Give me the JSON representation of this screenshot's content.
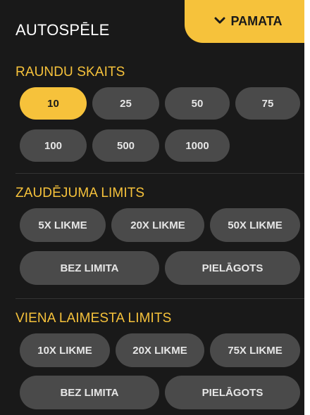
{
  "header": {
    "title": "AUTOSPĒLE",
    "tab_label": "PAMATA",
    "tab_icon": "chevron-down-icon"
  },
  "colors": {
    "accent": "#f6c23b",
    "panel_bg": "#191919",
    "button_bg": "#4a4a4a",
    "button_text": "#e6e6e6"
  },
  "rounds": {
    "title": "RAUNDU SKAITS",
    "options": [
      "10",
      "25",
      "50",
      "75",
      "100",
      "500",
      "1000"
    ],
    "selected": "10"
  },
  "loss_limit": {
    "title": "ZAUDĒJUMA LIMITS",
    "options": [
      "5X LIKME",
      "20X LIKME",
      "50X LIKME",
      "BEZ LIMITA",
      "PIELĀGOTS"
    ]
  },
  "single_win_limit": {
    "title": "VIENA LAIMESTA LIMITS",
    "options": [
      "10X LIKME",
      "20X LIKME",
      "75X LIKME",
      "BEZ LIMITA",
      "PIELĀGOTS"
    ]
  }
}
